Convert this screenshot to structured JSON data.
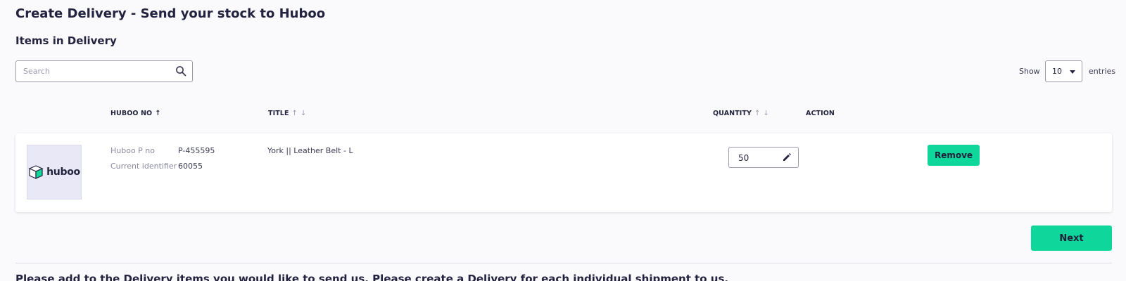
{
  "page": {
    "title": "Create Delivery - Send your stock to Huboo",
    "section_title": "Items in Delivery",
    "instructions": "Please add to the Delivery items you would like to send us. Please create a Delivery for each individual shipment to us."
  },
  "search": {
    "placeholder": "Search",
    "value": ""
  },
  "entries": {
    "show_label": "Show",
    "selected": "10",
    "suffix": "entries"
  },
  "table": {
    "headers": {
      "huboo_no": "HUBOO NO",
      "title": "TITLE",
      "quantity": "QUANTITY",
      "action": "ACTION"
    },
    "sort": {
      "active": "↑",
      "up": "↑",
      "down": "↓"
    },
    "rows": [
      {
        "logo_text": "huboo",
        "huboo_p_no_label": "Huboo P no",
        "huboo_p_no": "P-455595",
        "identifier_label": "Current identifier",
        "identifier": "60055",
        "title": "York || Leather Belt - L",
        "quantity": "50",
        "remove_label": "Remove"
      }
    ]
  },
  "buttons": {
    "next_label": "Next"
  },
  "colors": {
    "accent": "#0fd69b",
    "text": "#23233f",
    "background": "#fafafd"
  }
}
